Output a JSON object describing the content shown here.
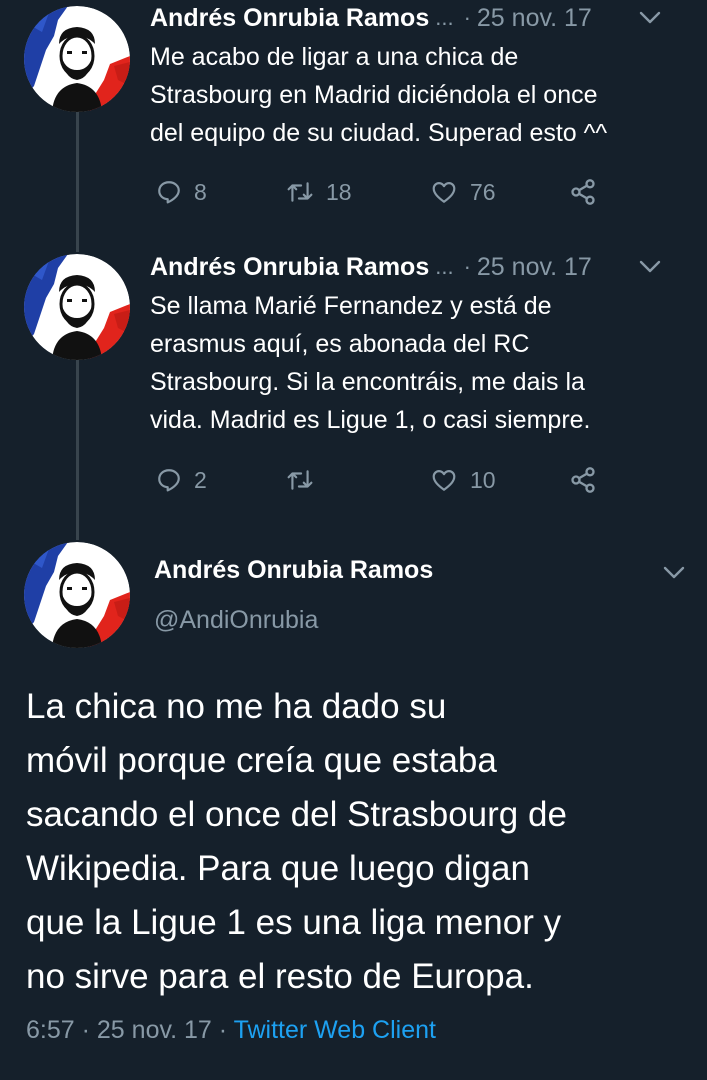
{
  "accent_color": "#1da1f2",
  "thread": [
    {
      "author_name": "Andrés Onrubia Ramos",
      "ellipsis": "...",
      "dot": "·",
      "date": "25 nov. 17",
      "text_lines": [
        "Me acabo de ligar a una chica de",
        "Strasbourg en Madrid diciéndola el once",
        "del equipo de su ciudad. Superad esto ^^"
      ],
      "reply_count": "8",
      "retweet_count": "18",
      "like_count": "76"
    },
    {
      "author_name": "Andrés Onrubia Ramos",
      "ellipsis": "...",
      "dot": "·",
      "date": "25 nov. 17",
      "text_lines": [
        "Se llama Marié Fernandez y está de",
        "erasmus aquí, es abonada del RC",
        "Strasbourg. Si la encontráis, me dais la",
        "vida. Madrid es Ligue 1, o casi siempre."
      ],
      "reply_count": "2",
      "retweet_count": "",
      "like_count": "10"
    }
  ],
  "main_tweet": {
    "author_name": "Andrés Onrubia Ramos",
    "handle": "@AndiOnrubia",
    "text_lines": [
      "La chica no me ha dado su",
      "móvil porque creía que estaba",
      "sacando el once del Strasbourg de",
      "Wikipedia. Para que luego digan",
      "que la Ligue 1 es una liga menor y",
      "no sirve para el resto de Europa."
    ],
    "time": "6:57",
    "sep1": "·",
    "date": "25 nov. 17",
    "sep2": "·",
    "client": "Twitter Web Client"
  },
  "icons": {
    "avatar": "avatar-bearded-man-french-flag",
    "menu": "chevron-down-icon",
    "reply": "reply-icon",
    "retweet": "retweet-icon",
    "like": "heart-icon",
    "share": "share-icon"
  }
}
